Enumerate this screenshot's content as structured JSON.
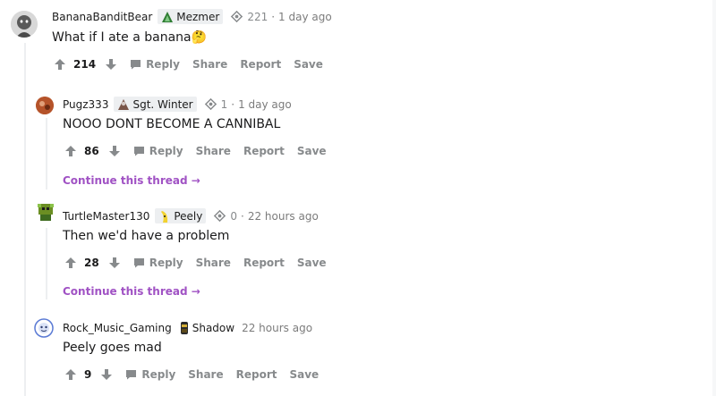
{
  "comments": [
    {
      "username": "BananaBanditBear",
      "flair": "Mezmer",
      "award_count": "221",
      "time": "1 day ago",
      "body": "What if I ate a banana",
      "emoji": "🤔",
      "score": "214",
      "actions": {
        "reply": "Reply",
        "share": "Share",
        "report": "Report",
        "save": "Save"
      }
    },
    {
      "username": "Pugz333",
      "flair": "Sgt. Winter",
      "award_count": "1",
      "time": "1 day ago",
      "body": "NOOO DONT BECOME A CANNIBAL",
      "score": "86",
      "actions": {
        "reply": "Reply",
        "share": "Share",
        "report": "Report",
        "save": "Save"
      },
      "continue": "Continue this thread"
    },
    {
      "username": "TurtleMaster130",
      "flair": "Peely",
      "award_count": "0",
      "time": "22 hours ago",
      "body": "Then we'd have a problem",
      "score": "28",
      "actions": {
        "reply": "Reply",
        "share": "Share",
        "report": "Report",
        "save": "Save"
      },
      "continue": "Continue this thread"
    },
    {
      "username": "Rock_Music_Gaming",
      "flair": "Shadow",
      "time": "22 hours ago",
      "body": "Peely goes mad",
      "score": "9",
      "actions": {
        "reply": "Reply",
        "share": "Share",
        "report": "Report",
        "save": "Save"
      }
    }
  ],
  "separator": "·",
  "continue_arrow": "→",
  "colors": {
    "link": "#a052c4",
    "meta": "#7c7c7c",
    "action": "#878a8c",
    "flair_bg": "#edeff1"
  }
}
